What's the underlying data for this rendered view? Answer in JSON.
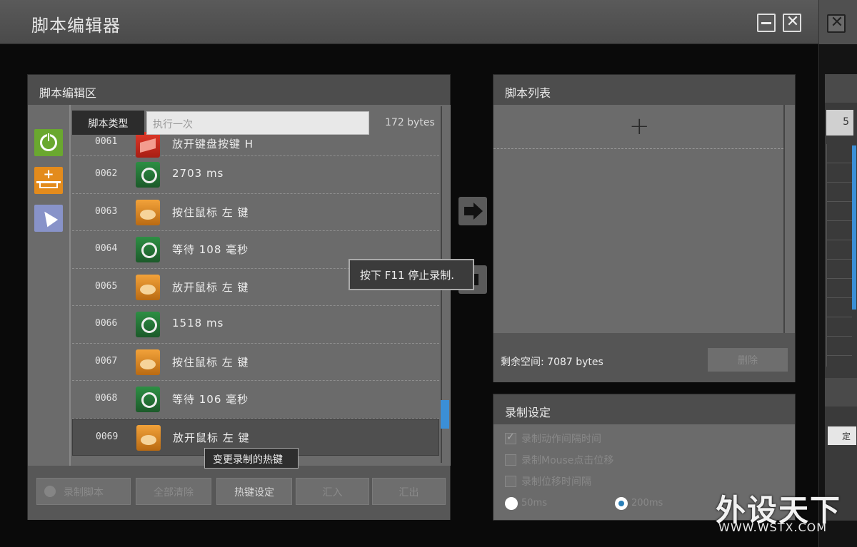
{
  "window": {
    "title": "脚本编辑器"
  },
  "editor": {
    "heading": "脚本编辑区",
    "script_type_label": "脚本类型",
    "script_type_value": "执行一次",
    "size": "172 bytes",
    "rows": [
      {
        "num": "0061",
        "icon": "key-release-icon",
        "text": "放开键盘按键  H"
      },
      {
        "num": "0062",
        "icon": "clock-icon",
        "text": "2703 ms"
      },
      {
        "num": "0063",
        "icon": "mouse-press-icon",
        "text": "按住鼠标  左  键"
      },
      {
        "num": "0064",
        "icon": "clock-icon",
        "text": "等待 108 毫秒"
      },
      {
        "num": "0065",
        "icon": "mouse-release-icon",
        "text": "放开鼠标  左  键"
      },
      {
        "num": "0066",
        "icon": "clock-icon",
        "text": "1518 ms"
      },
      {
        "num": "0067",
        "icon": "mouse-press-icon",
        "text": "按住鼠标  左  键"
      },
      {
        "num": "0068",
        "icon": "clock-icon",
        "text": "等待 106 毫秒"
      },
      {
        "num": "0069",
        "icon": "mouse-release-icon",
        "text": "放开鼠标  左  键"
      }
    ],
    "buttons": {
      "record": "录制脚本",
      "clear": "全部清除",
      "hotkey": "热键设定",
      "import": "汇入",
      "export": "汇出"
    }
  },
  "tooltips": {
    "f11": "按下 F11 停止录制.",
    "hotkey": "变更录制的热键"
  },
  "script_list": {
    "heading": "脚本列表",
    "add_symbol": "+",
    "free_space": "剩余空间: 7087 bytes",
    "delete": "删除"
  },
  "record_settings": {
    "heading": "录制设定",
    "options": [
      {
        "label": "录制动作间隔时间",
        "checked": true
      },
      {
        "label": "录制Mouse点击位移",
        "checked": false
      },
      {
        "label": "录制位移时间隔",
        "checked": false
      }
    ],
    "radios": [
      {
        "label": "50ms",
        "selected": false
      },
      {
        "label": "200ms",
        "selected": true
      }
    ]
  },
  "background_window": {
    "number": "5",
    "button": "定"
  },
  "watermark": {
    "main": "外设天下",
    "url": "WWW.WSTX.COM"
  },
  "colors": {
    "accent_blue": "#3b8fd6",
    "power_green": "#6aa82f",
    "insert_orange": "#e38b1c",
    "cursor_purple": "#8893c9"
  }
}
